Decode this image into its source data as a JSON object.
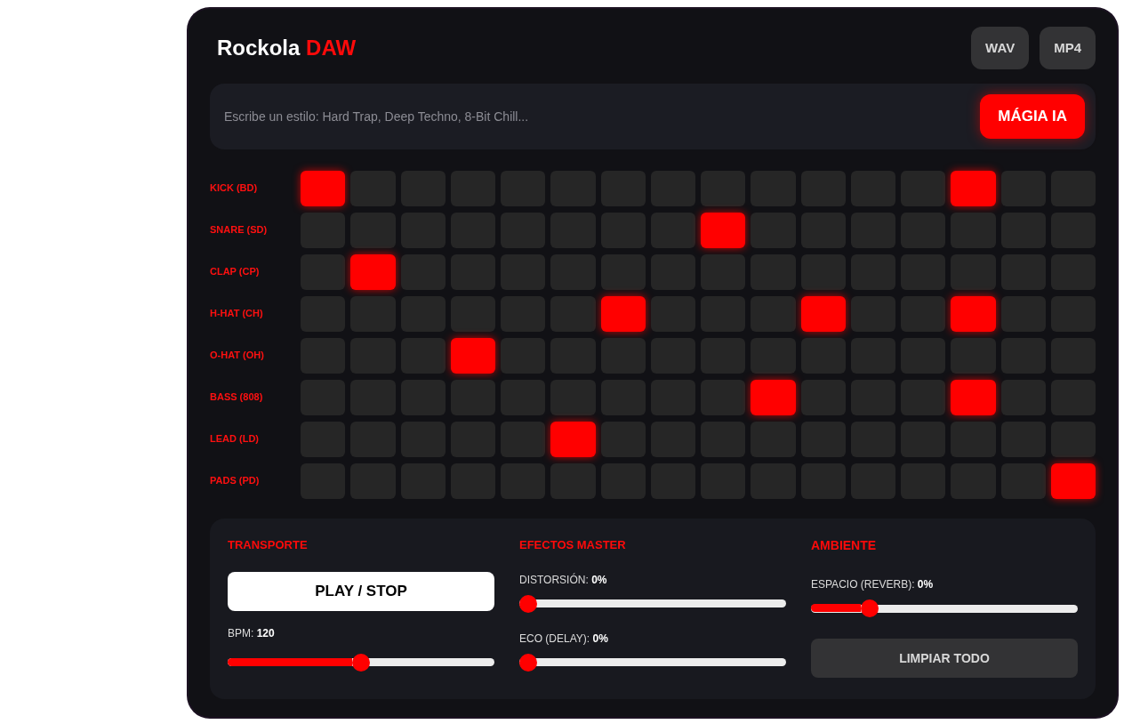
{
  "app": {
    "title": "Rockola",
    "title_accent": "DAW"
  },
  "export_buttons": [
    "WAV",
    "MP4"
  ],
  "prompt": {
    "placeholder": "Escribe un estilo: Hard Trap, Deep Techno, 8-Bit Chill...",
    "button": "MÁGIA IA"
  },
  "tracks": [
    {
      "name": "KICK (BD)",
      "steps": [
        true,
        false,
        false,
        false,
        false,
        false,
        false,
        false,
        false,
        false,
        false,
        false,
        false,
        true,
        false,
        false
      ]
    },
    {
      "name": "SNARE (SD)",
      "steps": [
        false,
        false,
        false,
        false,
        false,
        false,
        false,
        false,
        true,
        false,
        false,
        false,
        false,
        false,
        false,
        false
      ]
    },
    {
      "name": "CLAP (CP)",
      "steps": [
        false,
        true,
        false,
        false,
        false,
        false,
        false,
        false,
        false,
        false,
        false,
        false,
        false,
        false,
        false,
        false
      ]
    },
    {
      "name": "H-HAT (CH)",
      "steps": [
        false,
        false,
        false,
        false,
        false,
        false,
        true,
        false,
        false,
        false,
        true,
        false,
        false,
        true,
        false,
        false
      ]
    },
    {
      "name": "O-HAT (OH)",
      "steps": [
        false,
        false,
        false,
        true,
        false,
        false,
        false,
        false,
        false,
        false,
        false,
        false,
        false,
        false,
        false,
        false
      ]
    },
    {
      "name": "BASS (808)",
      "steps": [
        false,
        false,
        false,
        false,
        false,
        false,
        false,
        false,
        false,
        true,
        false,
        false,
        false,
        true,
        false,
        false
      ]
    },
    {
      "name": "LEAD (LD)",
      "steps": [
        false,
        false,
        false,
        false,
        false,
        true,
        false,
        false,
        false,
        false,
        false,
        false,
        false,
        false,
        false,
        false
      ]
    },
    {
      "name": "PADS (PD)",
      "steps": [
        false,
        false,
        false,
        false,
        false,
        false,
        false,
        false,
        false,
        false,
        false,
        false,
        false,
        false,
        false,
        true
      ]
    }
  ],
  "transport": {
    "title": "TRANSPORTE",
    "play_button": "PLAY / STOP",
    "bpm": {
      "label": "BPM:",
      "value": "120",
      "level": 0.5
    }
  },
  "effects": {
    "title": "EFECTOS MASTER",
    "controls": [
      {
        "label": "DISTORSIÓN:",
        "value": "0%",
        "level": 0
      },
      {
        "label": "ECO (DELAY):",
        "value": "0%",
        "level": 0
      }
    ]
  },
  "ambience": {
    "title": "AMBIENTE",
    "controls": [
      {
        "label": "ESPACIO (REVERB):",
        "value": "0%",
        "level": 0.2
      }
    ],
    "clear_button": "LIMPIAR TODO"
  }
}
